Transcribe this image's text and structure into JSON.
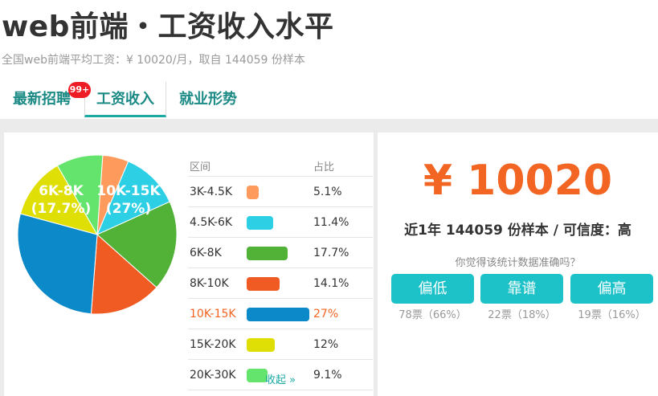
{
  "header": {
    "title": "web前端・工资收入水平",
    "subtitle": "全国web前端平均工资：¥ 10020/月，取自 144059 份样本"
  },
  "tabs": [
    {
      "label": "最新招聘",
      "badge": "99+",
      "active": false
    },
    {
      "label": "工资收入",
      "active": true
    },
    {
      "label": "就业形势",
      "active": false
    }
  ],
  "salary_table": {
    "col_range": "区间",
    "col_ratio": "占比",
    "rows": [
      {
        "range": "3K-4.5K",
        "percent_label": "5.1%",
        "value": 5.1,
        "color": "#fe9a5b",
        "highlight": false
      },
      {
        "range": "4.5K-6K",
        "percent_label": "11.4%",
        "value": 11.4,
        "color": "#2dcfe5",
        "highlight": false
      },
      {
        "range": "6K-8K",
        "percent_label": "17.7%",
        "value": 17.7,
        "color": "#52b137",
        "highlight": false
      },
      {
        "range": "8K-10K",
        "percent_label": "14.1%",
        "value": 14.1,
        "color": "#f05a23",
        "highlight": false
      },
      {
        "range": "10K-15K",
        "percent_label": "27%",
        "value": 27,
        "color": "#0b89c8",
        "highlight": true
      },
      {
        "range": "15K-20K",
        "percent_label": "12%",
        "value": 12,
        "color": "#dfdf05",
        "highlight": false
      },
      {
        "range": "20K-30K",
        "percent_label": "9.1%",
        "value": 9.1,
        "color": "#64e46c",
        "highlight": false
      }
    ],
    "collapse_label": "收起 »"
  },
  "chart_data": {
    "type": "pie",
    "title": "",
    "categories": [
      "3K-4.5K",
      "4.5K-6K",
      "6K-8K",
      "8K-10K",
      "10K-15K",
      "15K-20K",
      "20K-30K"
    ],
    "values": [
      5.1,
      11.4,
      17.7,
      14.1,
      27,
      12,
      9.1
    ],
    "colors": [
      "#fe9a5b",
      "#2dcfe5",
      "#52b137",
      "#f05a23",
      "#0b89c8",
      "#dfdf05",
      "#64e46c"
    ],
    "slice_labels": [
      {
        "range": "6K-8K",
        "percent": "(17.7%)"
      },
      {
        "range": "10K-15K",
        "percent": "(27%)"
      }
    ]
  },
  "summary": {
    "salary": "¥ 10020",
    "sample_line": "近1年 144059 份样本 / 可信度：高",
    "question": "你觉得该统计数据准确吗？"
  },
  "votes": [
    {
      "label": "偏低",
      "count": "78票（66%）"
    },
    {
      "label": "靠谱",
      "count": "22票（18%）"
    },
    {
      "label": "偏高",
      "count": "19票（16%）"
    }
  ]
}
